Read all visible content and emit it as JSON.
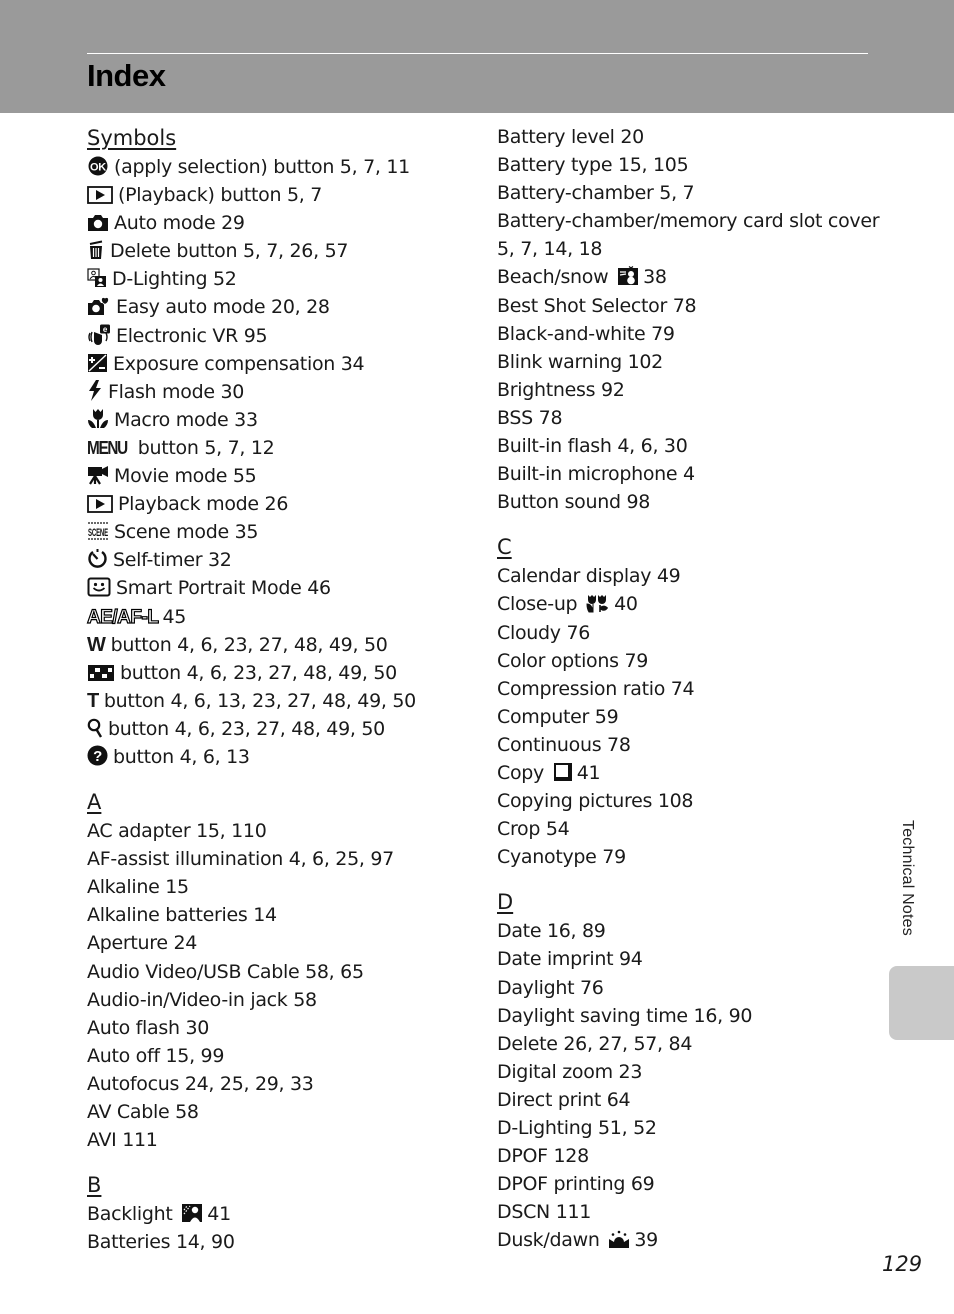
{
  "header": {
    "title": "Index"
  },
  "side_tab": {
    "label": "Technical Notes"
  },
  "page_number": "129",
  "left_column": {
    "symbols": {
      "heading": "Symbols",
      "entries": [
        {
          "icon": "ok-button-icon",
          "text": "(apply selection) button 5, 7, 11"
        },
        {
          "icon": "playback-button-icon",
          "text": "(Playback) button 5, 7"
        },
        {
          "icon": "camera-auto-mode-icon",
          "text": "Auto mode 29"
        },
        {
          "icon": "trash-delete-icon",
          "text": "Delete button 5, 7, 26, 57"
        },
        {
          "icon": "d-lighting-icon",
          "text": "D-Lighting 52"
        },
        {
          "icon": "easy-auto-mode-icon",
          "text": "Easy auto mode 20, 28"
        },
        {
          "icon": "electronic-vr-icon",
          "text": "Electronic VR 95"
        },
        {
          "icon": "exposure-compensation-icon",
          "text": "Exposure compensation 34"
        },
        {
          "icon": "flash-mode-icon",
          "text": "Flash mode 30"
        },
        {
          "icon": "macro-mode-icon",
          "text": "Macro mode 33"
        },
        {
          "icon": "menu-icon",
          "glyph": "MENU",
          "text": "button 5, 7, 12"
        },
        {
          "icon": "movie-mode-icon",
          "text": "Movie mode 55"
        },
        {
          "icon": "playback-mode-icon",
          "text": "Playback mode 26"
        },
        {
          "icon": "scene-mode-icon",
          "glyph": "SCENE",
          "text": "Scene mode 35"
        },
        {
          "icon": "self-timer-icon",
          "text": "Self-timer 32"
        },
        {
          "icon": "smart-portrait-icon",
          "text": "Smart Portrait Mode 46"
        },
        {
          "icon": "ae-af-lock-icon",
          "glyph": "AE/AF-L",
          "text": "45"
        },
        {
          "icon": "wide-zoom-icon",
          "glyph": "W",
          "text": "button 4, 6, 23, 27, 48, 49, 50"
        },
        {
          "icon": "thumbnail-icon",
          "text": "button 4, 6, 23, 27, 48, 49, 50"
        },
        {
          "icon": "tele-zoom-icon",
          "glyph": "T",
          "text": "button 4, 6, 13, 23, 27, 48, 49, 50"
        },
        {
          "icon": "playback-zoom-icon",
          "text": "button 4, 6, 23, 27, 48, 49, 50"
        },
        {
          "icon": "help-icon",
          "text": "button 4, 6, 13"
        }
      ]
    },
    "a": {
      "heading": "A",
      "entries": [
        "AC adapter 15, 110",
        "AF-assist illumination 4, 6, 25, 97",
        "Alkaline 15",
        "Alkaline batteries 14",
        "Aperture 24",
        "Audio Video/USB Cable 58, 65",
        "Audio-in/Video-in jack 58",
        "Auto flash 30",
        "Auto off 15, 99",
        "Autofocus 24, 25, 29, 33",
        "AV Cable 58",
        "AVI 111"
      ]
    },
    "b": {
      "heading": "B",
      "entries": [
        {
          "before": "Backlight",
          "icon": "backlight-icon",
          "after": "41"
        },
        {
          "text": "Batteries 14, 90"
        }
      ]
    }
  },
  "right_column": {
    "b_continued": {
      "entries": [
        {
          "text": "Battery level 20"
        },
        {
          "text": "Battery type 15, 105"
        },
        {
          "text": "Battery-chamber 5, 7"
        },
        {
          "text": "Battery-chamber/memory card slot cover"
        },
        {
          "text": "5, 7, 14, 18"
        },
        {
          "before": "Beach/snow",
          "icon": "beach-snow-icon",
          "after": "38"
        },
        {
          "text": "Best Shot Selector 78"
        },
        {
          "text": "Black-and-white 79"
        },
        {
          "text": "Blink warning 102"
        },
        {
          "text": "Brightness 92"
        },
        {
          "text": "BSS 78"
        },
        {
          "text": "Built-in flash 4, 6, 30"
        },
        {
          "text": "Built-in microphone 4"
        },
        {
          "text": "Button sound 98"
        }
      ]
    },
    "c": {
      "heading": "C",
      "entries": [
        {
          "text": "Calendar display 49"
        },
        {
          "before": "Close-up",
          "icon": "close-up-icon",
          "after": "40"
        },
        {
          "text": "Cloudy 76"
        },
        {
          "text": "Color options 79"
        },
        {
          "text": "Compression ratio 74"
        },
        {
          "text": "Computer 59"
        },
        {
          "text": "Continuous 78"
        },
        {
          "before": "Copy",
          "icon": "copy-icon",
          "after": "41"
        },
        {
          "text": "Copying pictures 108"
        },
        {
          "text": "Crop 54"
        },
        {
          "text": "Cyanotype 79"
        }
      ]
    },
    "d": {
      "heading": "D",
      "entries": [
        {
          "text": "Date 16, 89"
        },
        {
          "text": "Date imprint 94"
        },
        {
          "text": "Daylight 76"
        },
        {
          "text": "Daylight saving time 16, 90"
        },
        {
          "text": "Delete 26, 27, 57, 84"
        },
        {
          "text": "Digital zoom 23"
        },
        {
          "text": "Direct print 64"
        },
        {
          "text": "D-Lighting 51, 52"
        },
        {
          "text": "DPOF 128"
        },
        {
          "text": "DPOF printing 69"
        },
        {
          "text": "DSCN 111"
        },
        {
          "before": "Dusk/dawn",
          "icon": "dusk-dawn-icon",
          "after": "39"
        }
      ]
    }
  }
}
